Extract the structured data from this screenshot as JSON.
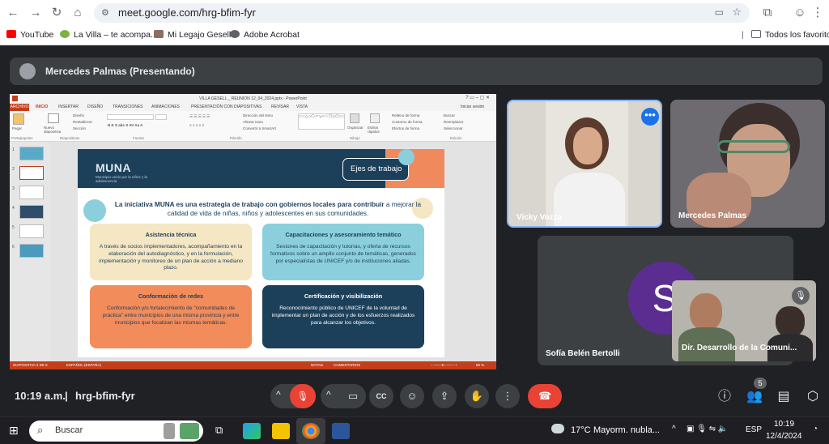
{
  "browser": {
    "url": "meet.google.com/hrg-bfim-fyr",
    "bookmarks": [
      {
        "label": "YouTube",
        "icon": "youtube-icon",
        "color": "#ff0000"
      },
      {
        "label": "La Villa – te acompa...",
        "icon": "leaf-icon",
        "color": "#7cb342"
      },
      {
        "label": "Mi Legajo Gesell",
        "icon": "legajo-icon",
        "color": "#8d6e63"
      },
      {
        "label": "Adobe Acrobat",
        "icon": "globe-icon",
        "color": "#5f6368"
      }
    ],
    "all_bookmarks": "Todos los favoritos"
  },
  "meet": {
    "presenter_label": "Mercedes Palmas (Presentando)",
    "meeting_time": "10:19 a.m.",
    "meeting_code": "hrg-bfim-fyr",
    "participant_count": "5",
    "participants": [
      {
        "name": "Vicky Vozza"
      },
      {
        "name": "Mercedes Palmas"
      },
      {
        "name": "Sofía Belén Bertolli",
        "avatar_letter": "S"
      },
      {
        "name": "Dir. Desarrollo de la Comuni..."
      }
    ],
    "accent_end_call": "#ea4335",
    "accent_tile_border": "#8ab4f8"
  },
  "powerpoint": {
    "window_title": "VILLA GESELL _ REUNION 12_04_2024.pptx - PowerPoint",
    "sign_in": "Iniciar sesión",
    "tabs": [
      "ARCHIVO",
      "INICIO",
      "INSERTAR",
      "DISEÑO",
      "TRANSICIONES",
      "ANIMACIONES",
      "PRESENTACIÓN CON DIAPOSITIVAS",
      "REVISAR",
      "VISTA"
    ],
    "ribbon": {
      "paste": "Pegar",
      "clipboard": "Portapapeles",
      "new_slide": "Nuevo diapositiva",
      "design": "Diseño",
      "reset": "Restablecer",
      "section": "Sección",
      "slides": "Diapositivas",
      "font": "Fuente",
      "paragraph": "Párrafo",
      "text_direction": "Dirección del texto",
      "align_text": "Alinear texto",
      "smartart": "Convertir a SmartArt",
      "drawing": "Dibujo",
      "arrange": "Organizar",
      "quick_styles": "Estilos rápidos",
      "shape_fill": "Relleno de forma",
      "shape_outline": "Contorno de forma",
      "shape_effects": "Efectos de forma",
      "find": "Buscar",
      "replace": "Reemplazar",
      "select": "Seleccionar",
      "editing": "Edición"
    },
    "slide_numbers": [
      "1",
      "2",
      "3",
      "4",
      "5",
      "6"
    ],
    "status": {
      "slide_info": "DIAPOSITIVA 2 DE 6",
      "language": "ESPAÑOL (ESPAÑA)",
      "notes": "NOTAS",
      "comments": "COMENTARIOS",
      "zoom": "80 %"
    },
    "brand_color": "#c43e1c"
  },
  "slide": {
    "logo": "MUNA",
    "tagline": "Municipio unido por la niñez y la adolescencia",
    "ejes": "Ejes de trabajo",
    "intro_bold": "La iniciativa MUNA es una estrategia de trabajo con gobiernos locales para contribuir",
    "intro_rest": " a mejorar la calidad de vida de niñas, niños y adolescentes en sus comunidades.",
    "cards": [
      {
        "title": "Asistencia técnica",
        "body": "A través de socios implementadores, acompañamiento en la elaboración del autodiagnóstico, y en la formulación, implementación y monitoreo de un plan de acción a mediano plazo.",
        "bg": "#f5e6c4",
        "color": "#1c3f5a"
      },
      {
        "title": "Capacitaciones y asesoramiento temático",
        "body": "Sesiones de capacitación y tutorías, y oferta de recursos formativos sobre un amplio conjunto de temáticas, generados por especialistas de UNICEF y/o de instituciones aliadas.",
        "bg": "#8ccfdc",
        "color": "#1c3f5a"
      },
      {
        "title": "Conformación de redes",
        "body": "Conformación y/o fortalecimiento de \"comunidades de práctica\" entre municipios de una misma provincia y entre municipios que focalizan las mismas temáticas.",
        "bg": "#f28c5b",
        "color": "#1c3f5a"
      },
      {
        "title": "Certificación y visibilización",
        "body": "Reconocimiento público de UNICEF de la voluntad de implementar un plan de acción y de los esfuerzos realizados para alcanzar los objetivos.",
        "bg": "#1c3f5a",
        "color": "#ffffff"
      }
    ]
  },
  "taskbar": {
    "search_placeholder": "Buscar",
    "weather": "17°C",
    "weather_desc": "Mayorm. nubla...",
    "language": "ESP",
    "time": "10:19",
    "date": "12/4/2024"
  }
}
